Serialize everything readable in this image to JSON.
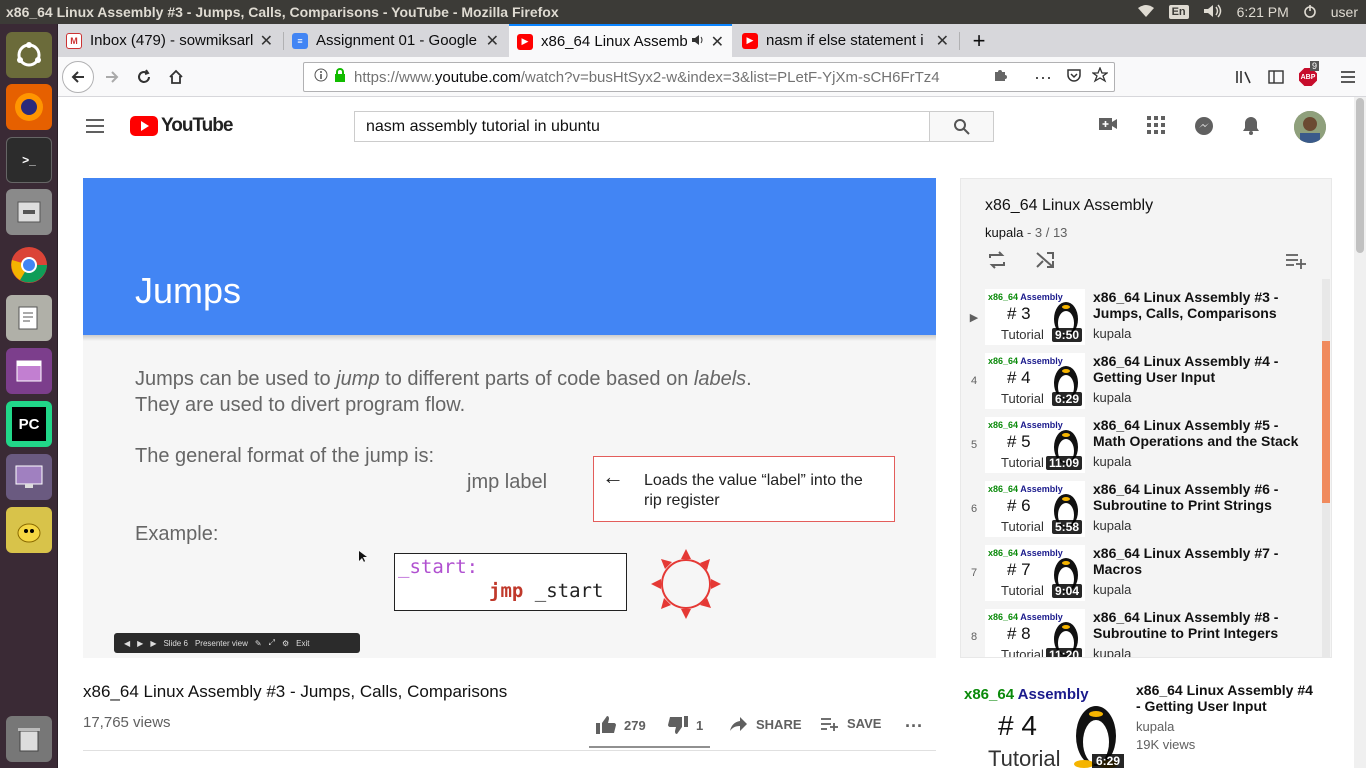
{
  "os": {
    "window_title": "x86_64 Linux Assembly #3 - Jumps, Calls, Comparisons - YouTube - Mozilla Firefox",
    "keyboard_layout": "En",
    "clock": "6:21 PM",
    "user": "user"
  },
  "browser": {
    "tabs": [
      {
        "label": "Inbox (479) - sowmiksarl",
        "icon": "gmail-icon"
      },
      {
        "label": "Assignment 01 - Google",
        "icon": "google-docs-icon"
      },
      {
        "label": "x86_64 Linux Assemb",
        "icon": "youtube-icon",
        "active": true
      },
      {
        "label": "nasm if else statement i",
        "icon": "youtube-icon"
      }
    ],
    "url_prefix": "https://www.",
    "url_domain": "youtube.com",
    "url_rest": "/watch?v=busHtSyx2-w&index=3&list=PLetF-YjXm-sCH6FrTz4",
    "abp_badge": "9"
  },
  "youtube": {
    "logo_text": "YouTube",
    "search_value": "nasm assembly tutorial in ubuntu",
    "video": {
      "slide_title": "Jumps",
      "line1_a": "Jumps can be used to ",
      "line1_em": "jump",
      "line1_b": " to different parts of code based on ",
      "line1_em2": "labels",
      "line1_c": ".",
      "line2": "They are used to divert program flow.",
      "line3": "The general format of the jump is:",
      "jmp_label": "jmp label",
      "note_arrow": "←",
      "note_text": "Loads the value “label” into the rip register",
      "example": "Example:",
      "code_label": "_start:",
      "code_kw": "jmp",
      "code_arg": " _start",
      "controls_slide": "Slide 6",
      "controls_presenter": "Presenter view",
      "controls_exit": "Exit"
    },
    "title": "x86_64 Linux Assembly #3 - Jumps, Calls, Comparisons",
    "views": "17,765 views",
    "likes": "279",
    "dislikes": "1",
    "share": "SHARE",
    "save": "SAVE",
    "playlist": {
      "title": "x86_64 Linux Assembly",
      "channel": "kupala",
      "position": "3 / 13",
      "items": [
        {
          "index": "▶",
          "num": "# 3",
          "duration": "9:50",
          "title": "x86_64 Linux Assembly #3 - Jumps, Calls, Comparisons",
          "channel": "kupala"
        },
        {
          "index": "4",
          "num": "# 4",
          "duration": "6:29",
          "title": "x86_64 Linux Assembly #4 - Getting User Input",
          "channel": "kupala"
        },
        {
          "index": "5",
          "num": "# 5",
          "duration": "11:09",
          "title": "x86_64 Linux Assembly #5 - Math Operations and the Stack",
          "channel": "kupala"
        },
        {
          "index": "6",
          "num": "# 6",
          "duration": "5:58",
          "title": "x86_64 Linux Assembly #6 - Subroutine to Print Strings",
          "channel": "kupala"
        },
        {
          "index": "7",
          "num": "# 7",
          "duration": "9:04",
          "title": "x86_64 Linux Assembly #7 - Macros",
          "channel": "kupala"
        },
        {
          "index": "8",
          "num": "# 8",
          "duration": "11:20",
          "title": "x86_64 Linux Assembly #8 - Subroutine to Print Integers",
          "channel": "kupala"
        }
      ],
      "thumb_label_a": "x86_64",
      "thumb_label_b": " Assembly",
      "thumb_tutorial": "Tutorial"
    },
    "next_up": {
      "num": "# 4",
      "duration": "6:29",
      "title": "x86_64 Linux Assembly #4 - Getting User Input",
      "channel": "kupala",
      "views": "19K views"
    }
  }
}
